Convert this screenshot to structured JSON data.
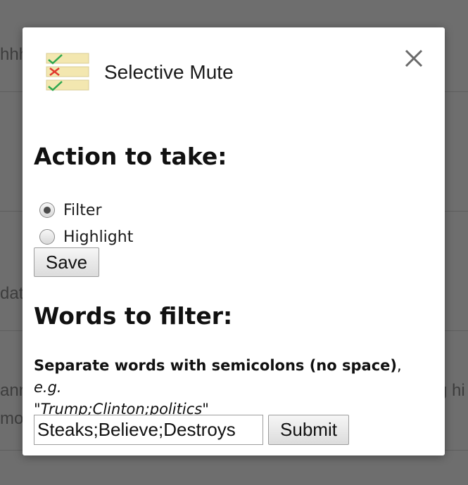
{
  "background": {
    "fragments": [
      "hhh",
      "dat",
      "ann",
      "mo",
      "g hi"
    ]
  },
  "modal": {
    "title": "Selective Mute",
    "close_label": "×",
    "logo_icon": "checklist-icon",
    "action_heading": "Action to take:",
    "action_options": [
      {
        "label": "Filter",
        "checked": true
      },
      {
        "label": "Highlight",
        "checked": false
      }
    ],
    "save_label": "Save",
    "words_heading": "Words to filter:",
    "instructions": {
      "bold": "Separate words with semicolons (no space)",
      "comma": ", ",
      "eg": "e.g.",
      "example_open": "\"",
      "example": "Trump;Clinton;politics",
      "example_close": "\""
    },
    "words_value": "Steaks;Believe;Destroys",
    "submit_label": "Submit"
  },
  "colors": {
    "overlay": "#6e6e6e",
    "check_green": "#2fa84f",
    "cross_red": "#e03a2f",
    "row_yellow": "#f3e7b0"
  }
}
